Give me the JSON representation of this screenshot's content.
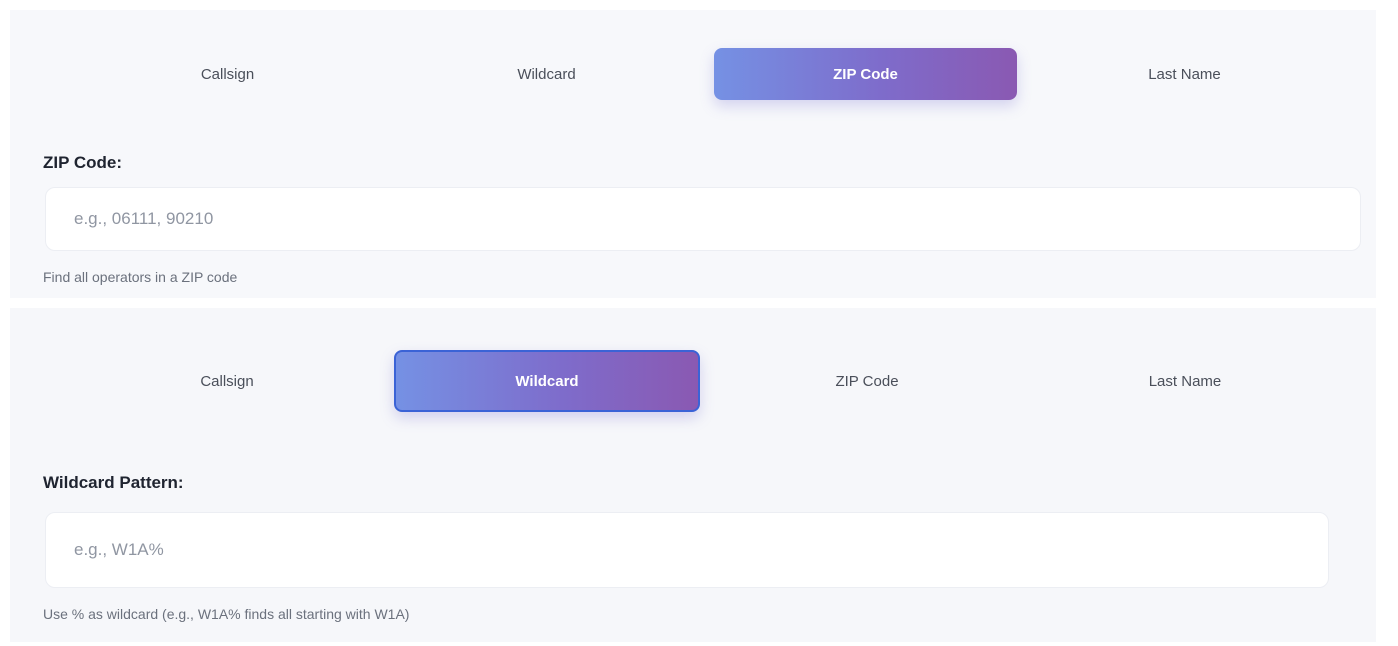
{
  "zip_panel": {
    "tabs": [
      {
        "label": "Callsign"
      },
      {
        "label": "Wildcard"
      },
      {
        "label": "ZIP Code"
      },
      {
        "label": "Last Name"
      }
    ],
    "active_tab": "ZIP Code",
    "field_label": "ZIP Code:",
    "input": {
      "value": "",
      "placeholder": "e.g., 06111, 90210"
    },
    "hint": "Find all operators in a ZIP code"
  },
  "wildcard_panel": {
    "tabs": [
      {
        "label": "Callsign"
      },
      {
        "label": "Wildcard"
      },
      {
        "label": "ZIP Code"
      },
      {
        "label": "Last Name"
      }
    ],
    "active_tab": "Wildcard",
    "field_label": "Wildcard Pattern:",
    "input": {
      "value": "",
      "placeholder": "e.g., W1A%"
    },
    "hint": "Use % as wildcard (e.g., W1A% finds all starting with W1A)"
  },
  "colors": {
    "active_tab_gradient_start": "#7591e4",
    "active_tab_gradient_end": "#8a59b2",
    "active_tab_border": "#3b63d6",
    "panel_background": "#f7f8fb"
  }
}
